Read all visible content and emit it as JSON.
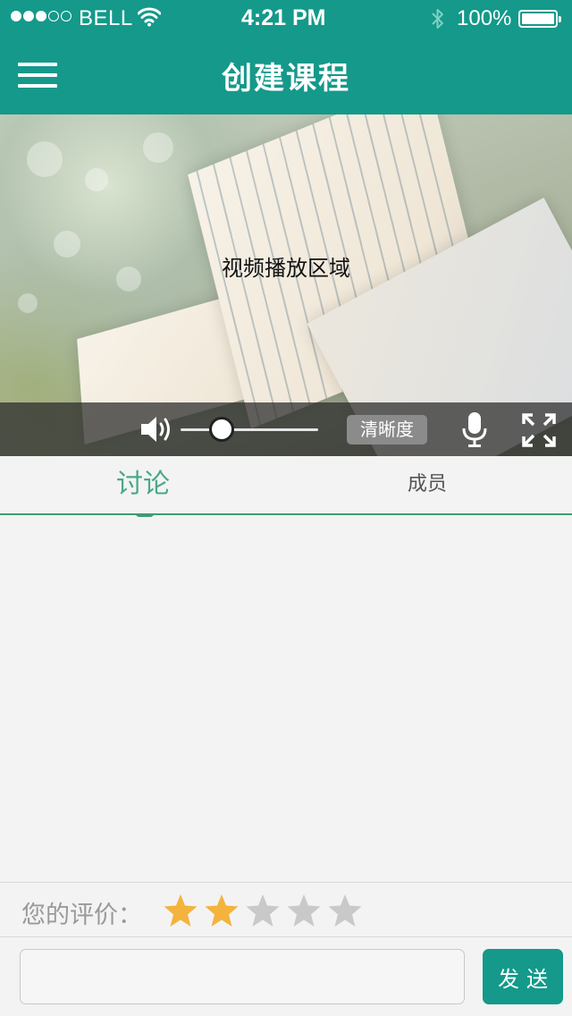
{
  "status_bar": {
    "signal_bars_filled": 3,
    "signal_bars_total": 5,
    "carrier": "BELL",
    "time": "4:21 PM",
    "battery": "100%",
    "icons": [
      "wifi-icon",
      "bluetooth-icon",
      "battery-icon"
    ]
  },
  "nav": {
    "title": "创建课程",
    "menu_icon": "hamburger-menu-icon"
  },
  "video": {
    "placeholder_text": "视频播放区域",
    "volume_level": 0.32,
    "quality_label": "清晰度",
    "icons": [
      "speaker-icon",
      "microphone-icon",
      "fullscreen-icon"
    ]
  },
  "tabs": {
    "items": [
      {
        "label": "讨论",
        "active": true
      },
      {
        "label": "成员",
        "active": false
      }
    ]
  },
  "rating": {
    "label": "您的评价：",
    "value": 2,
    "max": 5
  },
  "comment": {
    "value": "",
    "placeholder": "",
    "send_label": "发送"
  },
  "colors": {
    "brand": "#14998a",
    "tab_active": "#4aa888",
    "tab_underline": "#3e9d70",
    "star_on": "#f3b33d",
    "star_off": "#c9c9c9"
  }
}
